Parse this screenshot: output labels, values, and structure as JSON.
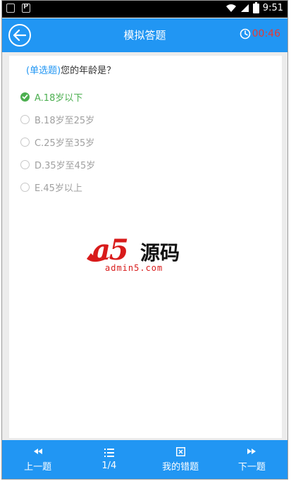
{
  "status_bar": {
    "time": "9:51"
  },
  "header": {
    "title": "模拟答题",
    "timer": "00:46"
  },
  "question": {
    "type_label": "(单选题)",
    "text": "您的年龄是？",
    "options": [
      {
        "label": "A.18岁以下",
        "selected": true
      },
      {
        "label": "B.18岁至25岁",
        "selected": false
      },
      {
        "label": "C.25岁至35岁",
        "selected": false
      },
      {
        "label": "D.35岁至45岁",
        "selected": false
      },
      {
        "label": "E.45岁以上",
        "selected": false
      }
    ]
  },
  "watermark": {
    "brand_cn": "源码",
    "brand_logo": "a5",
    "url": "admin5.com"
  },
  "bottom_nav": {
    "prev_label": "上一题",
    "progress_label": "1/4",
    "wrong_label": "我的错题",
    "next_label": "下一题"
  },
  "colors": {
    "primary": "#2196f3",
    "timer": "#e53935",
    "selected": "#4caf50"
  }
}
